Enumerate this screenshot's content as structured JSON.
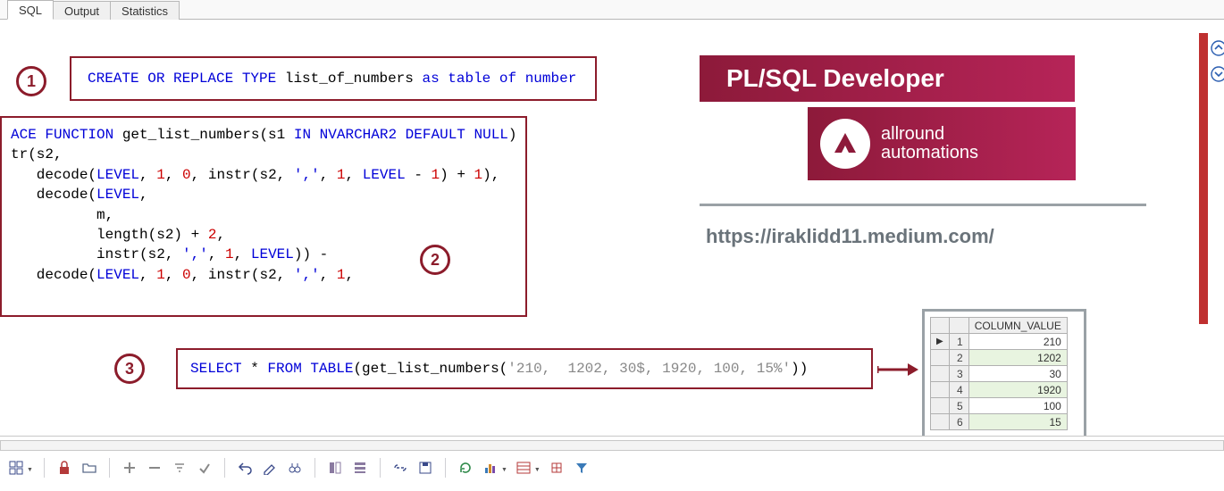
{
  "tabs": {
    "sql": "SQL",
    "output": "Output",
    "stats": "Statistics"
  },
  "badges": {
    "b1": "1",
    "b2": "2",
    "b3": "3"
  },
  "brand": {
    "title": "PL/SQL Developer",
    "line1": "allround",
    "line2": "automations"
  },
  "link": "https://iraklidd11.medium.com/",
  "code1": {
    "t1": "CREATE OR REPLACE TYPE ",
    "t2": "list_of_numbers ",
    "t3": "as table of number"
  },
  "code2": {
    "l1a": "ACE FUNCTION ",
    "l1b": "get_list_numbers(s1 ",
    "l1c": "IN NVARCHAR2 DEFAULT NULL",
    "l1d": ")",
    "l2": "tr(s2,",
    "l3a": "   decode(",
    "l3b": "LEVEL",
    "l3c": ", ",
    "l3d": "1",
    "l3e": ", ",
    "l3f": "0",
    "l3g": ", instr(s2, ",
    "l3h": "','",
    "l3i": ", ",
    "l3j": "1",
    "l3k": ", ",
    "l3l": "LEVEL",
    "l3m": " - ",
    "l3n": "1",
    "l3o": ") + ",
    "l3p": "1",
    "l3q": "),",
    "l4a": "   decode(",
    "l4b": "LEVEL",
    "l4c": ",",
    "l5": "          m,",
    "l6a": "          length(s2) + ",
    "l6b": "2",
    "l6c": ",",
    "l7a": "          instr(s2, ",
    "l7b": "','",
    "l7c": ", ",
    "l7d": "1",
    "l7e": ", ",
    "l7f": "LEVEL",
    "l7g": ")) -",
    "l8a": "   decode(",
    "l8b": "LEVEL",
    "l8c": ", ",
    "l8d": "1",
    "l8e": ", ",
    "l8f": "0",
    "l8g": ", instr(s2, ",
    "l8h": "','",
    "l8i": ", ",
    "l8j": "1",
    "l8k": ","
  },
  "code3": {
    "t1": "SELECT",
    "t2": " * ",
    "t3": "FROM TABLE",
    "t4": "(get_list_numbers(",
    "t5": "'210,  1202, 30$, 1920, 100, 15%'",
    "t6": "))"
  },
  "result": {
    "header": "COLUMN_VALUE",
    "rows": [
      {
        "n": "1",
        "v": "210"
      },
      {
        "n": "2",
        "v": "1202"
      },
      {
        "n": "3",
        "v": "30"
      },
      {
        "n": "4",
        "v": "1920"
      },
      {
        "n": "5",
        "v": "100"
      },
      {
        "n": "6",
        "v": "15"
      }
    ]
  }
}
